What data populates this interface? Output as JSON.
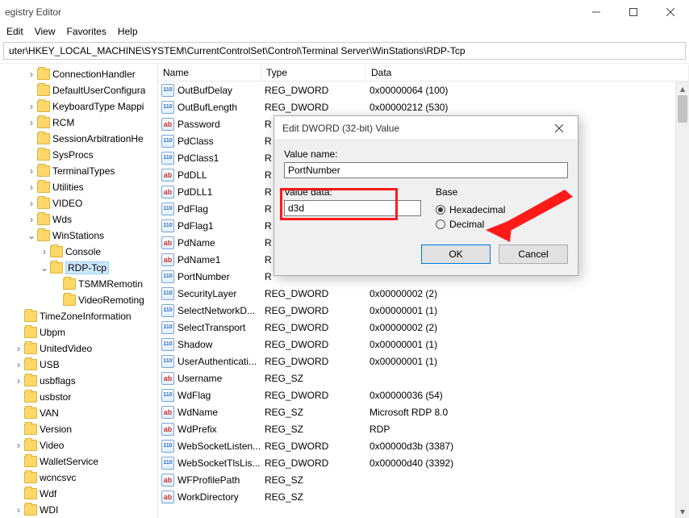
{
  "window": {
    "title": "egistry Editor"
  },
  "menu": [
    "Edit",
    "View",
    "Favorites",
    "Help"
  ],
  "address": "uter\\HKEY_LOCAL_MACHINE\\SYSTEM\\CurrentControlSet\\Control\\Terminal Server\\WinStations\\RDP-Tcp",
  "tree": [
    {
      "d": 2,
      "tw": ">",
      "label": "ConnectionHandler"
    },
    {
      "d": 2,
      "tw": "",
      "label": "DefaultUserConfigura"
    },
    {
      "d": 2,
      "tw": ">",
      "label": "KeyboardType Mappi"
    },
    {
      "d": 2,
      "tw": ">",
      "label": "RCM"
    },
    {
      "d": 2,
      "tw": "",
      "label": "SessionArbitrationHe"
    },
    {
      "d": 2,
      "tw": "",
      "label": "SysProcs"
    },
    {
      "d": 2,
      "tw": ">",
      "label": "TerminalTypes"
    },
    {
      "d": 2,
      "tw": ">",
      "label": "Utilities"
    },
    {
      "d": 2,
      "tw": ">",
      "label": "VIDEO"
    },
    {
      "d": 2,
      "tw": ">",
      "label": "Wds"
    },
    {
      "d": 2,
      "tw": "v",
      "label": "WinStations"
    },
    {
      "d": 3,
      "tw": ">",
      "label": "Console"
    },
    {
      "d": 3,
      "tw": "v",
      "label": "RDP-Tcp",
      "sel": true
    },
    {
      "d": 4,
      "tw": "",
      "label": "TSMMRemotin"
    },
    {
      "d": 4,
      "tw": "",
      "label": "VideoRemoting"
    },
    {
      "d": 1,
      "tw": "",
      "label": "TimeZoneInformation"
    },
    {
      "d": 1,
      "tw": "",
      "label": "Ubpm"
    },
    {
      "d": 1,
      "tw": ">",
      "label": "UnitedVideo"
    },
    {
      "d": 1,
      "tw": ">",
      "label": "USB"
    },
    {
      "d": 1,
      "tw": ">",
      "label": "usbflags"
    },
    {
      "d": 1,
      "tw": "",
      "label": "usbstor"
    },
    {
      "d": 1,
      "tw": "",
      "label": "VAN"
    },
    {
      "d": 1,
      "tw": "",
      "label": "Version"
    },
    {
      "d": 1,
      "tw": ">",
      "label": "Video"
    },
    {
      "d": 1,
      "tw": "",
      "label": "WalletService"
    },
    {
      "d": 1,
      "tw": "",
      "label": "wcncsvc"
    },
    {
      "d": 1,
      "tw": "",
      "label": "Wdf"
    },
    {
      "d": 1,
      "tw": ">",
      "label": "WDI"
    }
  ],
  "columns": {
    "name": "Name",
    "type": "Type",
    "data": "Data"
  },
  "rows": [
    {
      "icon": "dw",
      "name": "OutBufDelay",
      "type": "REG_DWORD",
      "data": "0x00000064 (100)"
    },
    {
      "icon": "dw",
      "name": "OutBufLength",
      "type": "REG_DWORD",
      "data": "0x00000212 (530)"
    },
    {
      "icon": "ab",
      "name": "Password",
      "type": "R",
      "data": ""
    },
    {
      "icon": "dw",
      "name": "PdClass",
      "type": "R",
      "data": ""
    },
    {
      "icon": "dw",
      "name": "PdClass1",
      "type": "R",
      "data": ""
    },
    {
      "icon": "ab",
      "name": "PdDLL",
      "type": "R",
      "data": ""
    },
    {
      "icon": "ab",
      "name": "PdDLL1",
      "type": "R",
      "data": ""
    },
    {
      "icon": "dw",
      "name": "PdFlag",
      "type": "R",
      "data": ""
    },
    {
      "icon": "dw",
      "name": "PdFlag1",
      "type": "R",
      "data": ""
    },
    {
      "icon": "ab",
      "name": "PdName",
      "type": "R",
      "data": ""
    },
    {
      "icon": "ab",
      "name": "PdName1",
      "type": "R",
      "data": ""
    },
    {
      "icon": "dw",
      "name": "PortNumber",
      "type": "R",
      "data": ""
    },
    {
      "icon": "dw",
      "name": "SecurityLayer",
      "type": "REG_DWORD",
      "data": "0x00000002 (2)"
    },
    {
      "icon": "dw",
      "name": "SelectNetworkD...",
      "type": "REG_DWORD",
      "data": "0x00000001 (1)"
    },
    {
      "icon": "dw",
      "name": "SelectTransport",
      "type": "REG_DWORD",
      "data": "0x00000002 (2)"
    },
    {
      "icon": "dw",
      "name": "Shadow",
      "type": "REG_DWORD",
      "data": "0x00000001 (1)"
    },
    {
      "icon": "dw",
      "name": "UserAuthenticati...",
      "type": "REG_DWORD",
      "data": "0x00000001 (1)"
    },
    {
      "icon": "ab",
      "name": "Username",
      "type": "REG_SZ",
      "data": ""
    },
    {
      "icon": "dw",
      "name": "WdFlag",
      "type": "REG_DWORD",
      "data": "0x00000036 (54)"
    },
    {
      "icon": "ab",
      "name": "WdName",
      "type": "REG_SZ",
      "data": "Microsoft RDP 8.0"
    },
    {
      "icon": "ab",
      "name": "WdPrefix",
      "type": "REG_SZ",
      "data": "RDP"
    },
    {
      "icon": "dw",
      "name": "WebSocketListen...",
      "type": "REG_DWORD",
      "data": "0x00000d3b (3387)"
    },
    {
      "icon": "dw",
      "name": "WebSocketTlsLis...",
      "type": "REG_DWORD",
      "data": "0x00000d40 (3392)"
    },
    {
      "icon": "ab",
      "name": "WFProfilePath",
      "type": "REG_SZ",
      "data": ""
    },
    {
      "icon": "ab",
      "name": "WorkDirectory",
      "type": "REG_SZ",
      "data": ""
    }
  ],
  "dialog": {
    "title": "Edit DWORD (32-bit) Value",
    "valueNameLabel": "Value name:",
    "valueName": "PortNumber",
    "valueDataLabel": "Value data:",
    "valueData": "d3d",
    "baseLabel": "Base",
    "hexLabel": "Hexadecimal",
    "decLabel": "Decimal",
    "ok": "OK",
    "cancel": "Cancel"
  }
}
